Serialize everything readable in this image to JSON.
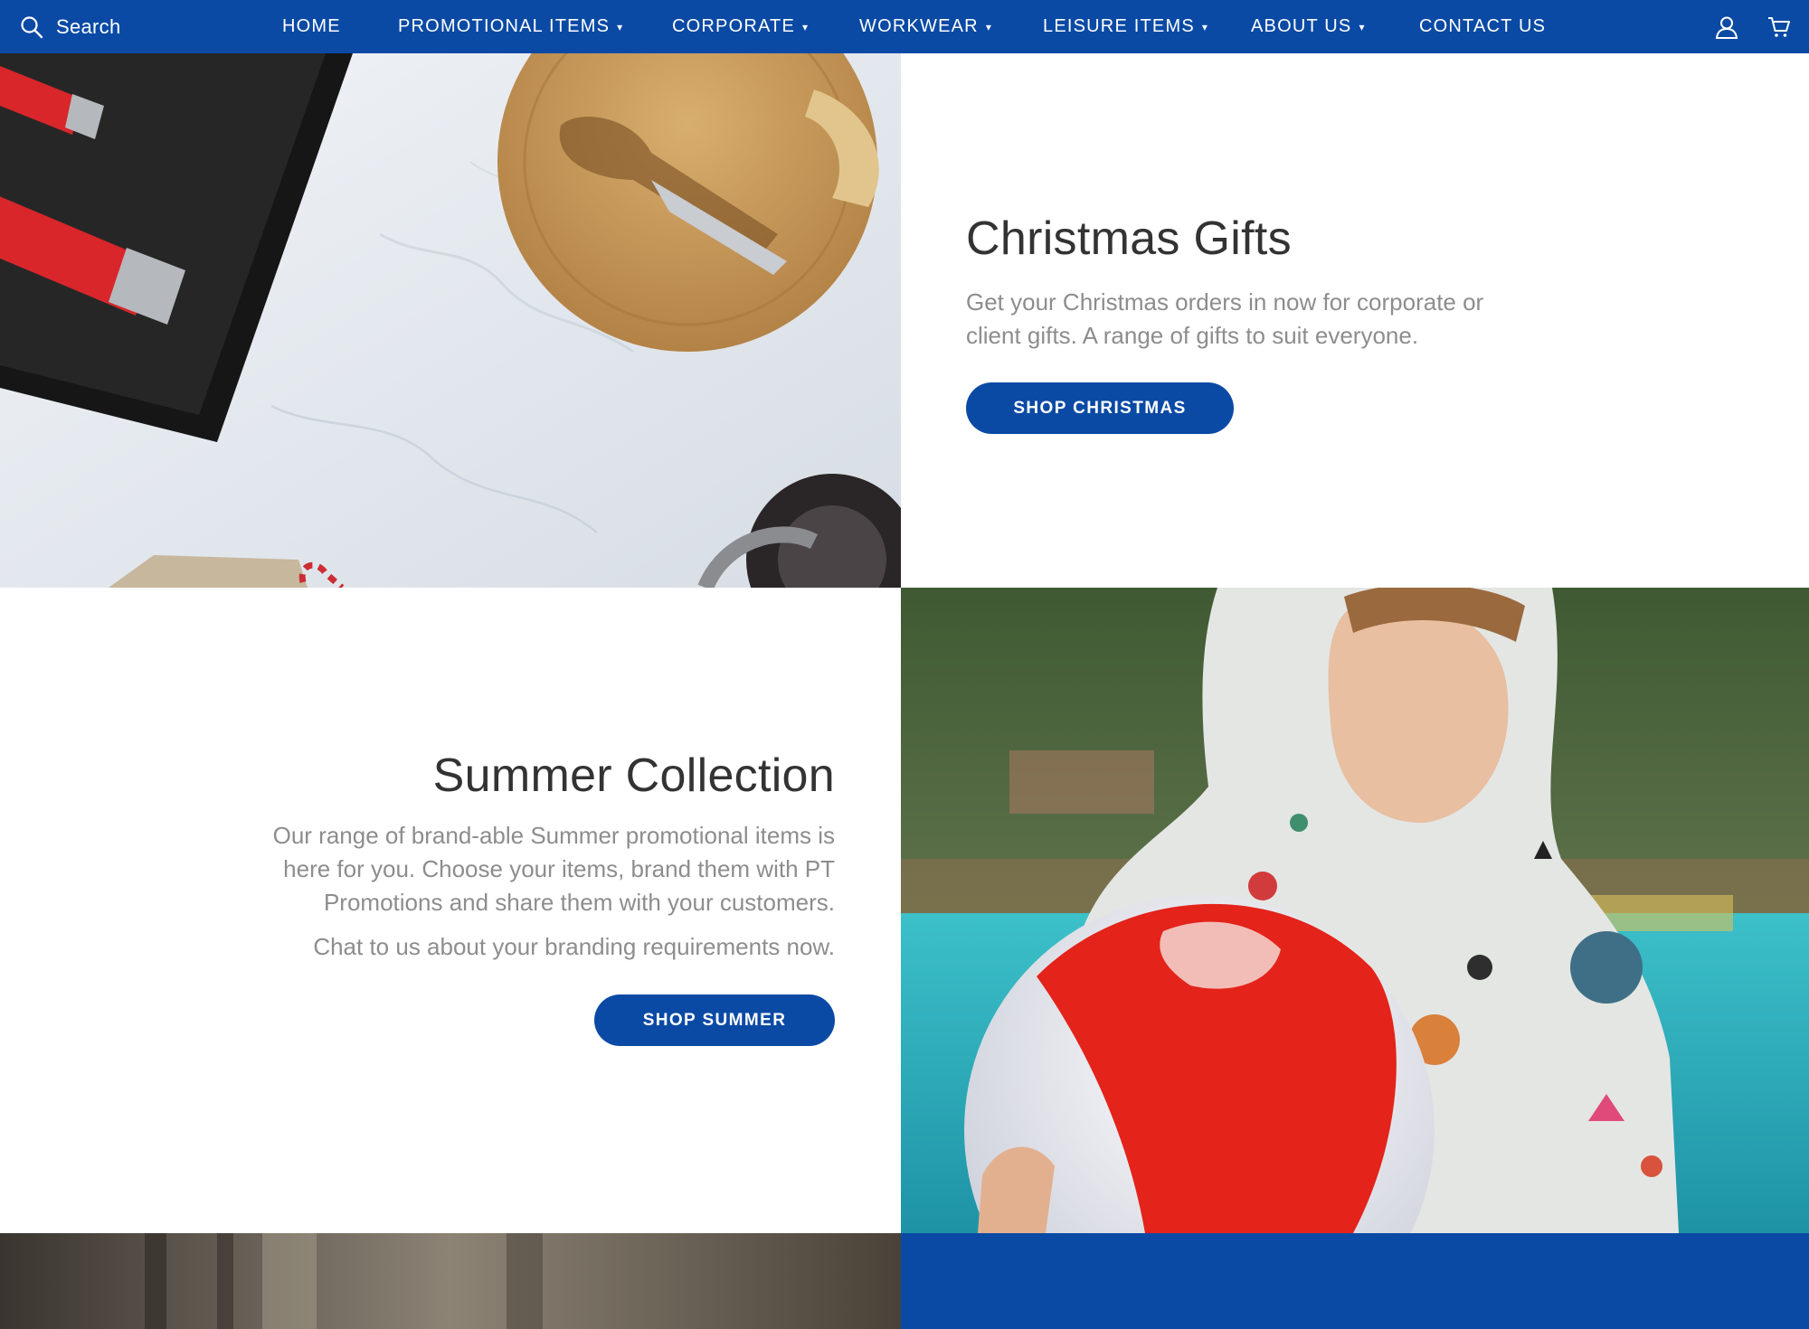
{
  "nav": {
    "search_label": "Search",
    "items": [
      {
        "label": "HOME",
        "dropdown": false
      },
      {
        "label": "PROMOTIONAL ITEMS",
        "dropdown": true
      },
      {
        "label": "CORPORATE",
        "dropdown": true
      },
      {
        "label": "WORKWEAR",
        "dropdown": true
      },
      {
        "label": "LEISURE ITEMS",
        "dropdown": true
      },
      {
        "label": "ABOUT US",
        "dropdown": true
      },
      {
        "label": "CONTACT US",
        "dropdown": false
      }
    ],
    "caret": "▾",
    "icons": [
      "search-icon",
      "account-icon",
      "cart-icon"
    ]
  },
  "christmas": {
    "title": "Christmas Gifts",
    "description": "Get your Christmas orders in now for corporate or client gifts. A range of gifts to suit everyone.",
    "button_label": "SHOP CHRISTMAS"
  },
  "summer": {
    "title": "Summer Collection",
    "description_1": "Our range of brand-able Summer promotional items is here for you. Choose your items, brand them with PT Promotions and share them with your customers.",
    "description_2": "Chat to us about your branding requirements now.",
    "button_label": "SHOP SUMMER"
  },
  "colors": {
    "brand_blue": "#0a4aa5",
    "heading": "#333333",
    "body_text": "#8d8d8d"
  }
}
